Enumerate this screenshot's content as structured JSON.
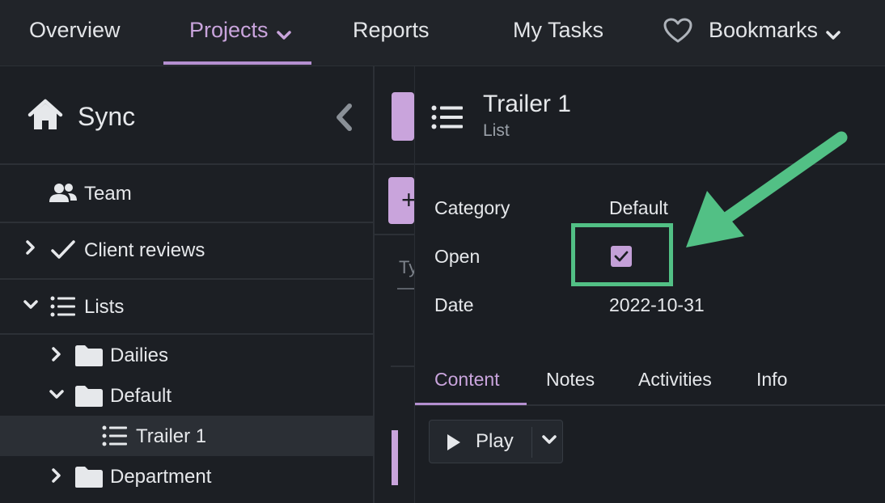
{
  "topnav": {
    "items": [
      {
        "label": "Overview"
      },
      {
        "label": "Projects",
        "active": true,
        "dropdown": true
      },
      {
        "label": "Reports"
      },
      {
        "label": "My Tasks"
      },
      {
        "label": "Bookmarks",
        "dropdown": true,
        "icon": "heart-icon"
      }
    ]
  },
  "sidebar": {
    "title": "Sync",
    "home_icon": "home-icon",
    "collapse_icon": "chevron-left-icon",
    "tree": [
      {
        "label": "Team",
        "icon": "team-icon"
      },
      {
        "label": "Client reviews",
        "icon": "check-icon",
        "expand": "collapsed"
      },
      {
        "label": "Lists",
        "icon": "list-icon",
        "expand": "expanded"
      },
      {
        "label": "Dailies",
        "icon": "folder-icon",
        "expand": "collapsed"
      },
      {
        "label": "Default",
        "icon": "folder-icon",
        "expand": "expanded"
      },
      {
        "label": "Trailer 1",
        "icon": "list-icon",
        "selected": true
      },
      {
        "label": "Department",
        "icon": "folder-icon",
        "expand": "collapsed"
      }
    ]
  },
  "middle": {
    "partial_text": "Ty"
  },
  "detail": {
    "title": "Trailer 1",
    "subtitle": "List",
    "properties": [
      {
        "label": "Category",
        "value": "Default"
      },
      {
        "label": "Open",
        "checked": true
      },
      {
        "label": "Date",
        "value": "2022-10-31"
      }
    ],
    "tabs": [
      {
        "label": "Content",
        "active": true
      },
      {
        "label": "Notes"
      },
      {
        "label": "Activities"
      },
      {
        "label": "Info"
      }
    ],
    "play_button": {
      "label": "Play"
    }
  },
  "colors": {
    "accent": "#c9a4dc",
    "annotation": "#52c085",
    "background": "#1b1e23"
  }
}
